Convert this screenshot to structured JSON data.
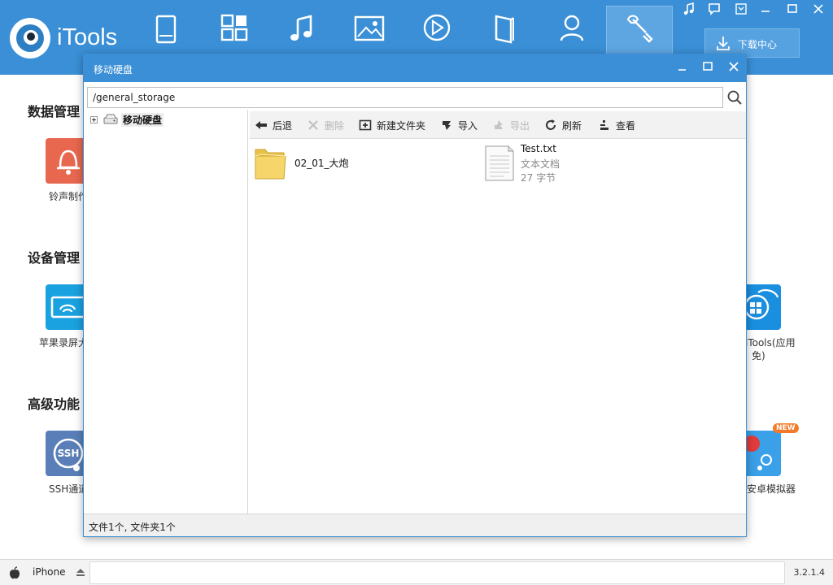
{
  "app": {
    "name": "iTools",
    "version": "3.2.1.4"
  },
  "topbar": {
    "nav_icons": [
      "device-icon",
      "apps-icon",
      "music-icon",
      "photo-icon",
      "video-icon",
      "books-icon",
      "contacts-icon",
      "toolbox-icon"
    ],
    "active_nav": "toolbox-icon",
    "download_center_label": "下载中心",
    "system_buttons": [
      "music-player-icon",
      "feedback-icon",
      "menu-icon",
      "minimize-icon",
      "maximize-icon",
      "close-icon"
    ]
  },
  "background": {
    "sections": [
      {
        "title": "数据管理"
      },
      {
        "title": "设备管理"
      },
      {
        "title": "高级功能"
      }
    ],
    "apps": [
      {
        "label": "铃声制作",
        "icon": "bell-icon",
        "color": "#e8674f"
      },
      {
        "label": "苹果录屏大",
        "icon": "screen-mirror-icon",
        "color": "#1aa2e0"
      },
      {
        "label": "SSH通道",
        "icon": "ssh-icon",
        "color": "#5a7fb8"
      },
      {
        "label": "iTools(应用",
        "label2": "免)",
        "icon": "itools-app-icon",
        "color": "#1a8fe0"
      },
      {
        "label": "安卓模拟器",
        "icon": "android-emulator-icon",
        "color": "#3aa0e8",
        "badge": "NEW"
      }
    ]
  },
  "statusbar": {
    "device_name": "iPhone",
    "version": "3.2.1.4"
  },
  "dialog": {
    "title": "移动硬盘",
    "path_value": "/general_storage",
    "tree": {
      "root_label": "移动硬盘"
    },
    "toolbar": {
      "back": "后退",
      "delete": "删除",
      "new_folder": "新建文件夹",
      "import": "导入",
      "export": "导出",
      "refresh": "刷新",
      "view": "查看"
    },
    "files": [
      {
        "name": "02_01_大炮",
        "type": "folder"
      },
      {
        "name": "Test.txt",
        "type": "file",
        "kind": "文本文档",
        "size": "27 字节"
      }
    ],
    "status": "文件1个, 文件夹1个"
  }
}
